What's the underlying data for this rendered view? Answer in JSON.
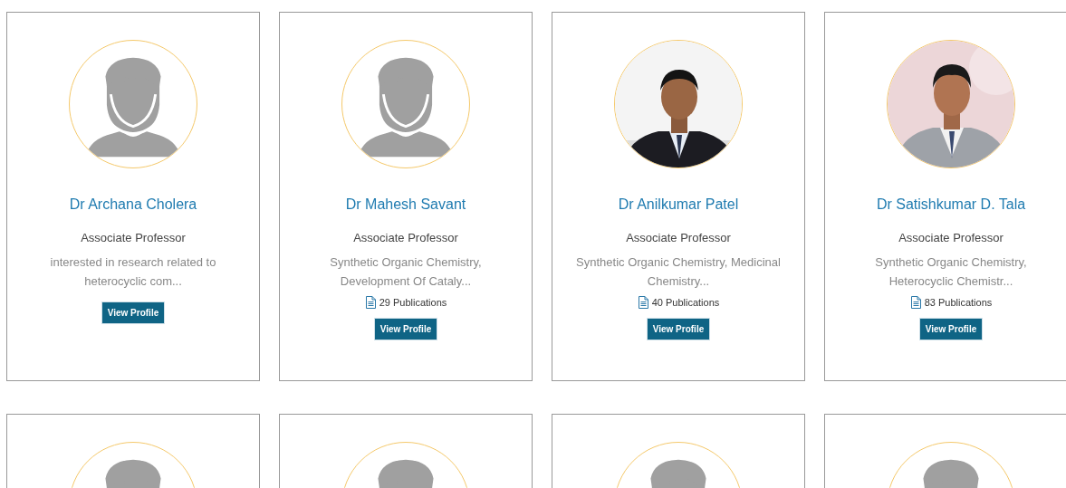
{
  "cards": [
    {
      "kind": "default",
      "name": "Dr Archana Cholera",
      "role": "Associate Professor",
      "interests": "interested in research related to heterocyclic com...",
      "button": "View Profile"
    },
    {
      "kind": "default",
      "name": "Dr Mahesh Savant",
      "role": "Associate Professor",
      "interests": "Synthetic Organic Chemistry, Development Of Cataly...",
      "publications": "29 Publications",
      "button": "View Profile"
    },
    {
      "name": "Dr Anilkumar Patel",
      "role": "Associate Professor",
      "interests": "Synthetic Organic Chemistry, Medicinal Chemistry...",
      "publications": "40 Publications",
      "button": "View Profile"
    },
    {
      "name": "Dr Satishkumar D. Tala",
      "role": "Associate Professor",
      "interests": "Synthetic Organic Chemistry, Heterocyclic Chemistr...",
      "publications": "83 Publications",
      "button": "View Profile"
    },
    {
      "kind": "default"
    },
    {
      "kind": "default"
    },
    {
      "kind": "default"
    },
    {
      "kind": "default"
    }
  ]
}
